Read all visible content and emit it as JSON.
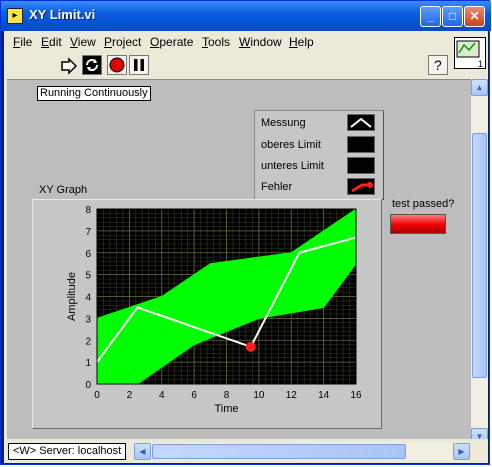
{
  "window": {
    "title": "XY Limit.vi"
  },
  "menu": [
    {
      "pre": "",
      "u": "F",
      "post": "ile"
    },
    {
      "pre": "",
      "u": "E",
      "post": "dit"
    },
    {
      "pre": "",
      "u": "V",
      "post": "iew"
    },
    {
      "pre": "",
      "u": "P",
      "post": "roject"
    },
    {
      "pre": "",
      "u": "O",
      "post": "perate"
    },
    {
      "pre": "",
      "u": "T",
      "post": "ools"
    },
    {
      "pre": "",
      "u": "W",
      "post": "indow"
    },
    {
      "pre": "",
      "u": "H",
      "post": "elp"
    }
  ],
  "vi_icon_text": "1",
  "running_label": "Running Continuously",
  "legend": [
    {
      "name": "Messung",
      "style": "white-line"
    },
    {
      "name": "oberes Limit",
      "style": "black"
    },
    {
      "name": "unteres Limit",
      "style": "black"
    },
    {
      "name": "Fehler",
      "style": "red-point"
    }
  ],
  "graph_label": "XY Graph",
  "indicator_label": "test passed?",
  "indicator_color": "#e00000",
  "status": {
    "server": "<W> Server: localhost"
  },
  "chart_data": {
    "type": "line",
    "title": "XY Graph",
    "xlabel": "Time",
    "ylabel": "Amplitude",
    "xlim": [
      0,
      16
    ],
    "ylim": [
      0,
      8
    ],
    "xticks": [
      0,
      2,
      4,
      6,
      8,
      10,
      12,
      14,
      16
    ],
    "yticks": [
      0,
      1,
      2,
      3,
      4,
      5,
      6,
      7,
      8
    ],
    "grid": true,
    "background": "#000000",
    "series": [
      {
        "name": "oberes Limit",
        "color": "#00ff00",
        "x": [
          0,
          4,
          7,
          12,
          16
        ],
        "y": [
          3,
          4,
          5.5,
          6,
          8
        ]
      },
      {
        "name": "unteres Limit",
        "color": "#00ff00",
        "x": [
          0,
          2.5,
          6,
          10,
          14,
          16
        ],
        "y": [
          0,
          0,
          1.8,
          3,
          3.5,
          5.5
        ]
      },
      {
        "name": "Messung",
        "color": "#ffffff",
        "x": [
          0,
          2.5,
          9.5,
          12.5,
          16
        ],
        "y": [
          1,
          3.5,
          1.7,
          6,
          6.7
        ]
      },
      {
        "name": "Fehler",
        "color": "#ff2020",
        "x": [
          9.5
        ],
        "y": [
          1.7
        ]
      }
    ]
  }
}
